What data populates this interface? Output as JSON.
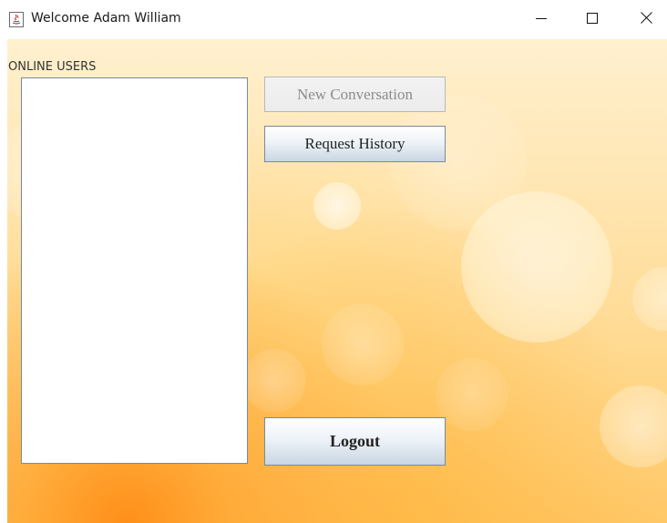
{
  "window": {
    "title": "Welcome Adam William",
    "app_icon": "java-icon",
    "controls": {
      "minimize_icon": "minimize-icon",
      "maximize_icon": "maximize-icon",
      "close_icon": "close-icon"
    }
  },
  "users_panel": {
    "label": "ONLINE USERS",
    "users": []
  },
  "actions": {
    "new_conversation": {
      "label": "New Conversation",
      "enabled": false
    },
    "request_history": {
      "label": "Request History",
      "enabled": true
    },
    "logout": {
      "label": "Logout",
      "enabled": true
    }
  },
  "colors": {
    "background_accent": "#ffc766",
    "button_border": "#7a8a9a"
  }
}
